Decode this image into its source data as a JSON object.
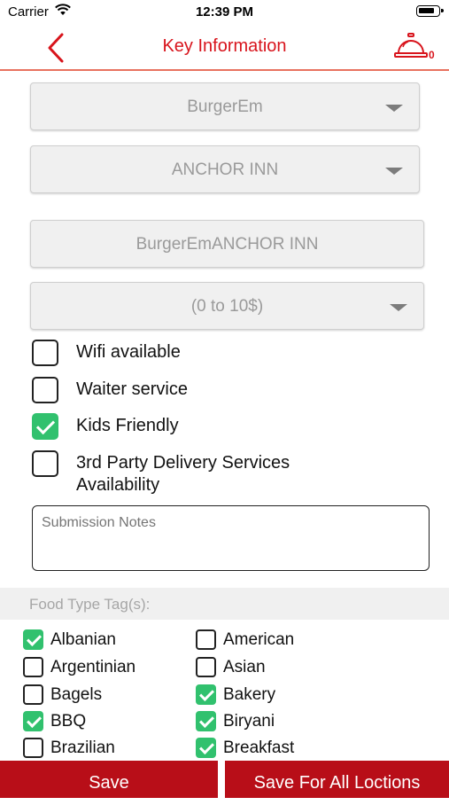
{
  "status": {
    "carrier": "Carrier",
    "time": "12:39 PM"
  },
  "nav": {
    "title": "Key Information",
    "bell_count": "0"
  },
  "form": {
    "cuisine_dropdown": "BurgerEm",
    "location_dropdown": "ANCHOR INN",
    "restaurant_name": "BurgerEmANCHOR INN",
    "price_dropdown": "(0 to 10$)",
    "amenities": [
      {
        "label": "Wifi available",
        "checked": false
      },
      {
        "label": "Waiter service",
        "checked": false
      },
      {
        "label": "Kids Friendly",
        "checked": true
      },
      {
        "label": "3rd Party Delivery Services Availability",
        "checked": false
      }
    ],
    "notes_placeholder": "Submission Notes"
  },
  "tags": {
    "header": "Food Type Tag(s):",
    "items": [
      {
        "label": "Albanian",
        "checked": true
      },
      {
        "label": "American",
        "checked": false
      },
      {
        "label": "Argentinian",
        "checked": false
      },
      {
        "label": "Asian",
        "checked": false
      },
      {
        "label": "Bagels",
        "checked": false
      },
      {
        "label": "Bakery",
        "checked": true
      },
      {
        "label": "BBQ",
        "checked": true
      },
      {
        "label": "Biryani",
        "checked": true
      },
      {
        "label": "Brazilian",
        "checked": false
      },
      {
        "label": "Breakfast",
        "checked": true
      }
    ]
  },
  "buttons": {
    "save": "Save",
    "save_all": "Save For All Loctions"
  },
  "colors": {
    "accent": "#d8141c",
    "button": "#b80e18",
    "check": "#31c16e",
    "divider": "#e8725f"
  },
  "icons": {
    "back": "chevron-left-icon",
    "bell": "service-bell-icon",
    "wifi": "wifi-icon",
    "battery": "battery-icon"
  }
}
